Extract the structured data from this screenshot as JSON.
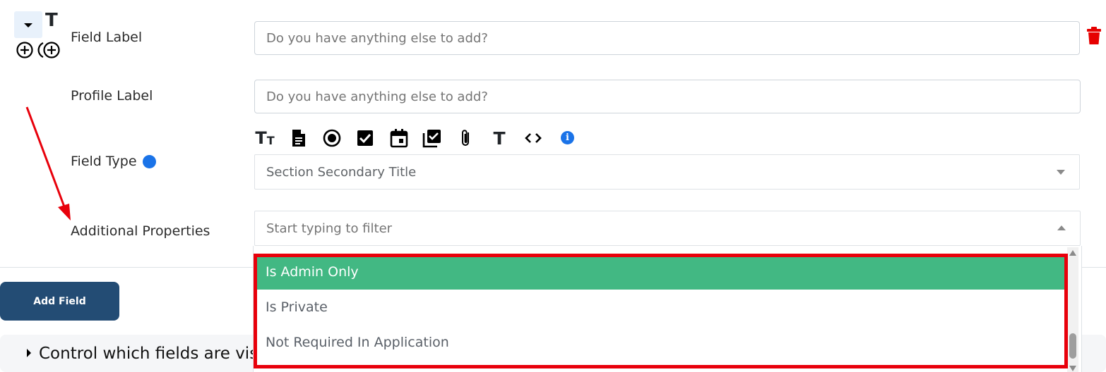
{
  "row_controls": {
    "toggle_icon": "caret-down-icon",
    "text_icon_glyph": "T",
    "add_icon": "plus-circle-icon",
    "add_nested_icon": "plus-circle-nested-icon"
  },
  "field_label": {
    "label": "Field Label",
    "value": "",
    "placeholder": "Do you have anything else to add?"
  },
  "profile_label": {
    "label": "Profile Label",
    "value": "",
    "placeholder": "Do you have anything else to add?"
  },
  "field_type": {
    "label": "Field Type",
    "selected": "Section Secondary Title",
    "type_icons": [
      "text-size-icon",
      "document-icon",
      "radio-icon",
      "checkbox-icon",
      "calendar-icon",
      "checklist-icon",
      "paperclip-icon",
      "text-icon",
      "code-icon",
      "info-icon"
    ]
  },
  "additional_properties": {
    "label": "Additional Properties",
    "placeholder": "Start typing to filter",
    "options": [
      "Is Admin Only",
      "Is Private",
      "Not Required In Application"
    ],
    "highlighted_index": 0
  },
  "add_field_button": "Add Field",
  "control_section": {
    "text": "Control which fields are vis"
  },
  "colors": {
    "highlight": "#42b883",
    "primary_button": "#234c74",
    "delete": "#e60000",
    "annotation_red": "#e8000b",
    "info": "#1a73e8"
  }
}
